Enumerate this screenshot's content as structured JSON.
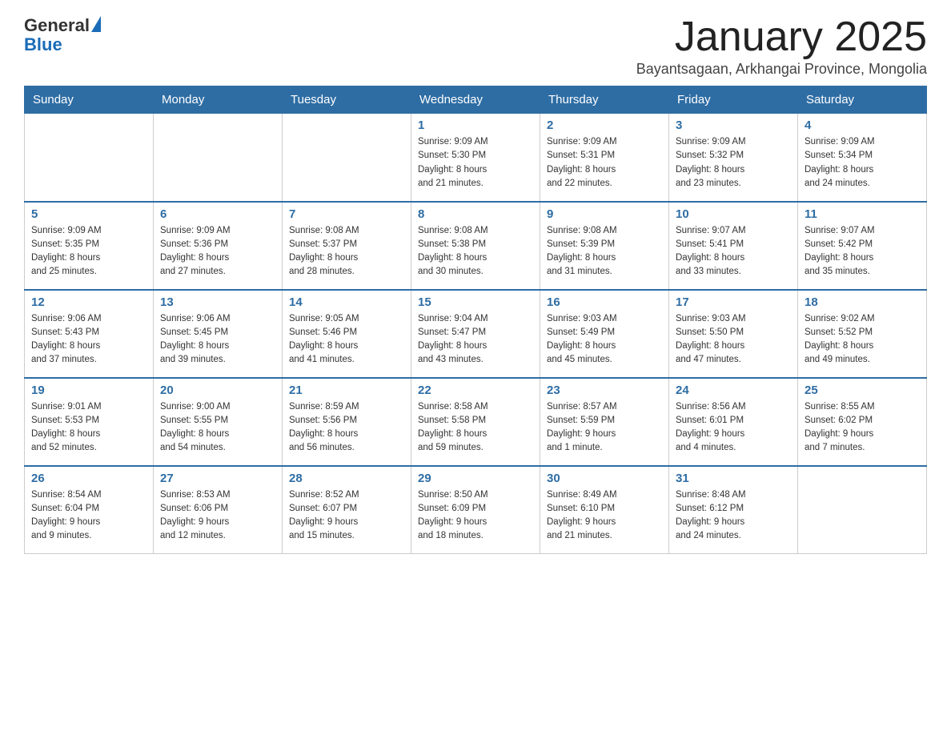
{
  "logo": {
    "text_general": "General",
    "text_blue": "Blue"
  },
  "title": "January 2025",
  "location": "Bayantsagaan, Arkhangai Province, Mongolia",
  "days_of_week": [
    "Sunday",
    "Monday",
    "Tuesday",
    "Wednesday",
    "Thursday",
    "Friday",
    "Saturday"
  ],
  "weeks": [
    [
      {
        "day": "",
        "info": ""
      },
      {
        "day": "",
        "info": ""
      },
      {
        "day": "",
        "info": ""
      },
      {
        "day": "1",
        "info": "Sunrise: 9:09 AM\nSunset: 5:30 PM\nDaylight: 8 hours\nand 21 minutes."
      },
      {
        "day": "2",
        "info": "Sunrise: 9:09 AM\nSunset: 5:31 PM\nDaylight: 8 hours\nand 22 minutes."
      },
      {
        "day": "3",
        "info": "Sunrise: 9:09 AM\nSunset: 5:32 PM\nDaylight: 8 hours\nand 23 minutes."
      },
      {
        "day": "4",
        "info": "Sunrise: 9:09 AM\nSunset: 5:34 PM\nDaylight: 8 hours\nand 24 minutes."
      }
    ],
    [
      {
        "day": "5",
        "info": "Sunrise: 9:09 AM\nSunset: 5:35 PM\nDaylight: 8 hours\nand 25 minutes."
      },
      {
        "day": "6",
        "info": "Sunrise: 9:09 AM\nSunset: 5:36 PM\nDaylight: 8 hours\nand 27 minutes."
      },
      {
        "day": "7",
        "info": "Sunrise: 9:08 AM\nSunset: 5:37 PM\nDaylight: 8 hours\nand 28 minutes."
      },
      {
        "day": "8",
        "info": "Sunrise: 9:08 AM\nSunset: 5:38 PM\nDaylight: 8 hours\nand 30 minutes."
      },
      {
        "day": "9",
        "info": "Sunrise: 9:08 AM\nSunset: 5:39 PM\nDaylight: 8 hours\nand 31 minutes."
      },
      {
        "day": "10",
        "info": "Sunrise: 9:07 AM\nSunset: 5:41 PM\nDaylight: 8 hours\nand 33 minutes."
      },
      {
        "day": "11",
        "info": "Sunrise: 9:07 AM\nSunset: 5:42 PM\nDaylight: 8 hours\nand 35 minutes."
      }
    ],
    [
      {
        "day": "12",
        "info": "Sunrise: 9:06 AM\nSunset: 5:43 PM\nDaylight: 8 hours\nand 37 minutes."
      },
      {
        "day": "13",
        "info": "Sunrise: 9:06 AM\nSunset: 5:45 PM\nDaylight: 8 hours\nand 39 minutes."
      },
      {
        "day": "14",
        "info": "Sunrise: 9:05 AM\nSunset: 5:46 PM\nDaylight: 8 hours\nand 41 minutes."
      },
      {
        "day": "15",
        "info": "Sunrise: 9:04 AM\nSunset: 5:47 PM\nDaylight: 8 hours\nand 43 minutes."
      },
      {
        "day": "16",
        "info": "Sunrise: 9:03 AM\nSunset: 5:49 PM\nDaylight: 8 hours\nand 45 minutes."
      },
      {
        "day": "17",
        "info": "Sunrise: 9:03 AM\nSunset: 5:50 PM\nDaylight: 8 hours\nand 47 minutes."
      },
      {
        "day": "18",
        "info": "Sunrise: 9:02 AM\nSunset: 5:52 PM\nDaylight: 8 hours\nand 49 minutes."
      }
    ],
    [
      {
        "day": "19",
        "info": "Sunrise: 9:01 AM\nSunset: 5:53 PM\nDaylight: 8 hours\nand 52 minutes."
      },
      {
        "day": "20",
        "info": "Sunrise: 9:00 AM\nSunset: 5:55 PM\nDaylight: 8 hours\nand 54 minutes."
      },
      {
        "day": "21",
        "info": "Sunrise: 8:59 AM\nSunset: 5:56 PM\nDaylight: 8 hours\nand 56 minutes."
      },
      {
        "day": "22",
        "info": "Sunrise: 8:58 AM\nSunset: 5:58 PM\nDaylight: 8 hours\nand 59 minutes."
      },
      {
        "day": "23",
        "info": "Sunrise: 8:57 AM\nSunset: 5:59 PM\nDaylight: 9 hours\nand 1 minute."
      },
      {
        "day": "24",
        "info": "Sunrise: 8:56 AM\nSunset: 6:01 PM\nDaylight: 9 hours\nand 4 minutes."
      },
      {
        "day": "25",
        "info": "Sunrise: 8:55 AM\nSunset: 6:02 PM\nDaylight: 9 hours\nand 7 minutes."
      }
    ],
    [
      {
        "day": "26",
        "info": "Sunrise: 8:54 AM\nSunset: 6:04 PM\nDaylight: 9 hours\nand 9 minutes."
      },
      {
        "day": "27",
        "info": "Sunrise: 8:53 AM\nSunset: 6:06 PM\nDaylight: 9 hours\nand 12 minutes."
      },
      {
        "day": "28",
        "info": "Sunrise: 8:52 AM\nSunset: 6:07 PM\nDaylight: 9 hours\nand 15 minutes."
      },
      {
        "day": "29",
        "info": "Sunrise: 8:50 AM\nSunset: 6:09 PM\nDaylight: 9 hours\nand 18 minutes."
      },
      {
        "day": "30",
        "info": "Sunrise: 8:49 AM\nSunset: 6:10 PM\nDaylight: 9 hours\nand 21 minutes."
      },
      {
        "day": "31",
        "info": "Sunrise: 8:48 AM\nSunset: 6:12 PM\nDaylight: 9 hours\nand 24 minutes."
      },
      {
        "day": "",
        "info": ""
      }
    ]
  ]
}
